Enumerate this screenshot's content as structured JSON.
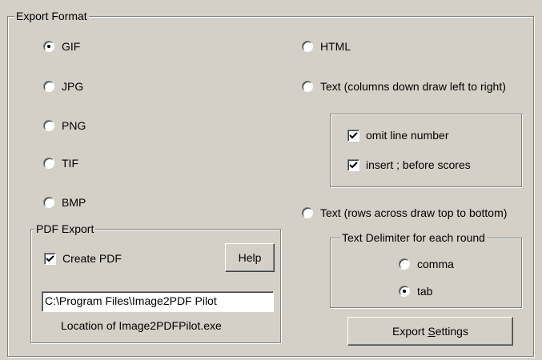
{
  "export_format": {
    "legend": "Export Format",
    "left_options": [
      {
        "label": "GIF",
        "selected": true
      },
      {
        "label": "JPG",
        "selected": false
      },
      {
        "label": "PNG",
        "selected": false
      },
      {
        "label": "TIF",
        "selected": false
      },
      {
        "label": "BMP",
        "selected": false
      }
    ],
    "html_option": {
      "label": "HTML",
      "selected": false
    },
    "text_columns_option": {
      "label": "Text (columns down draw left to right)",
      "selected": false
    },
    "column_options": [
      {
        "label": "omit line number",
        "checked": true
      },
      {
        "label": "insert ; before scores",
        "checked": true
      }
    ],
    "text_rows_option": {
      "label": "Text (rows across draw top to bottom)",
      "selected": false
    }
  },
  "pdf_export": {
    "legend": "PDF Export",
    "create_pdf": {
      "label": "Create PDF",
      "checked": true
    },
    "help_button": "Help",
    "path_value": "C:\\Program Files\\Image2PDF Pilot",
    "location_caption": "Location of Image2PDFPilot.exe"
  },
  "text_delimiter": {
    "legend": "Text Delimiter for each round",
    "options": [
      {
        "label": "comma",
        "selected": false
      },
      {
        "label": "tab",
        "selected": true
      }
    ]
  },
  "export_settings_button": {
    "prefix": "Export ",
    "accel": "S",
    "suffix": "ettings"
  }
}
